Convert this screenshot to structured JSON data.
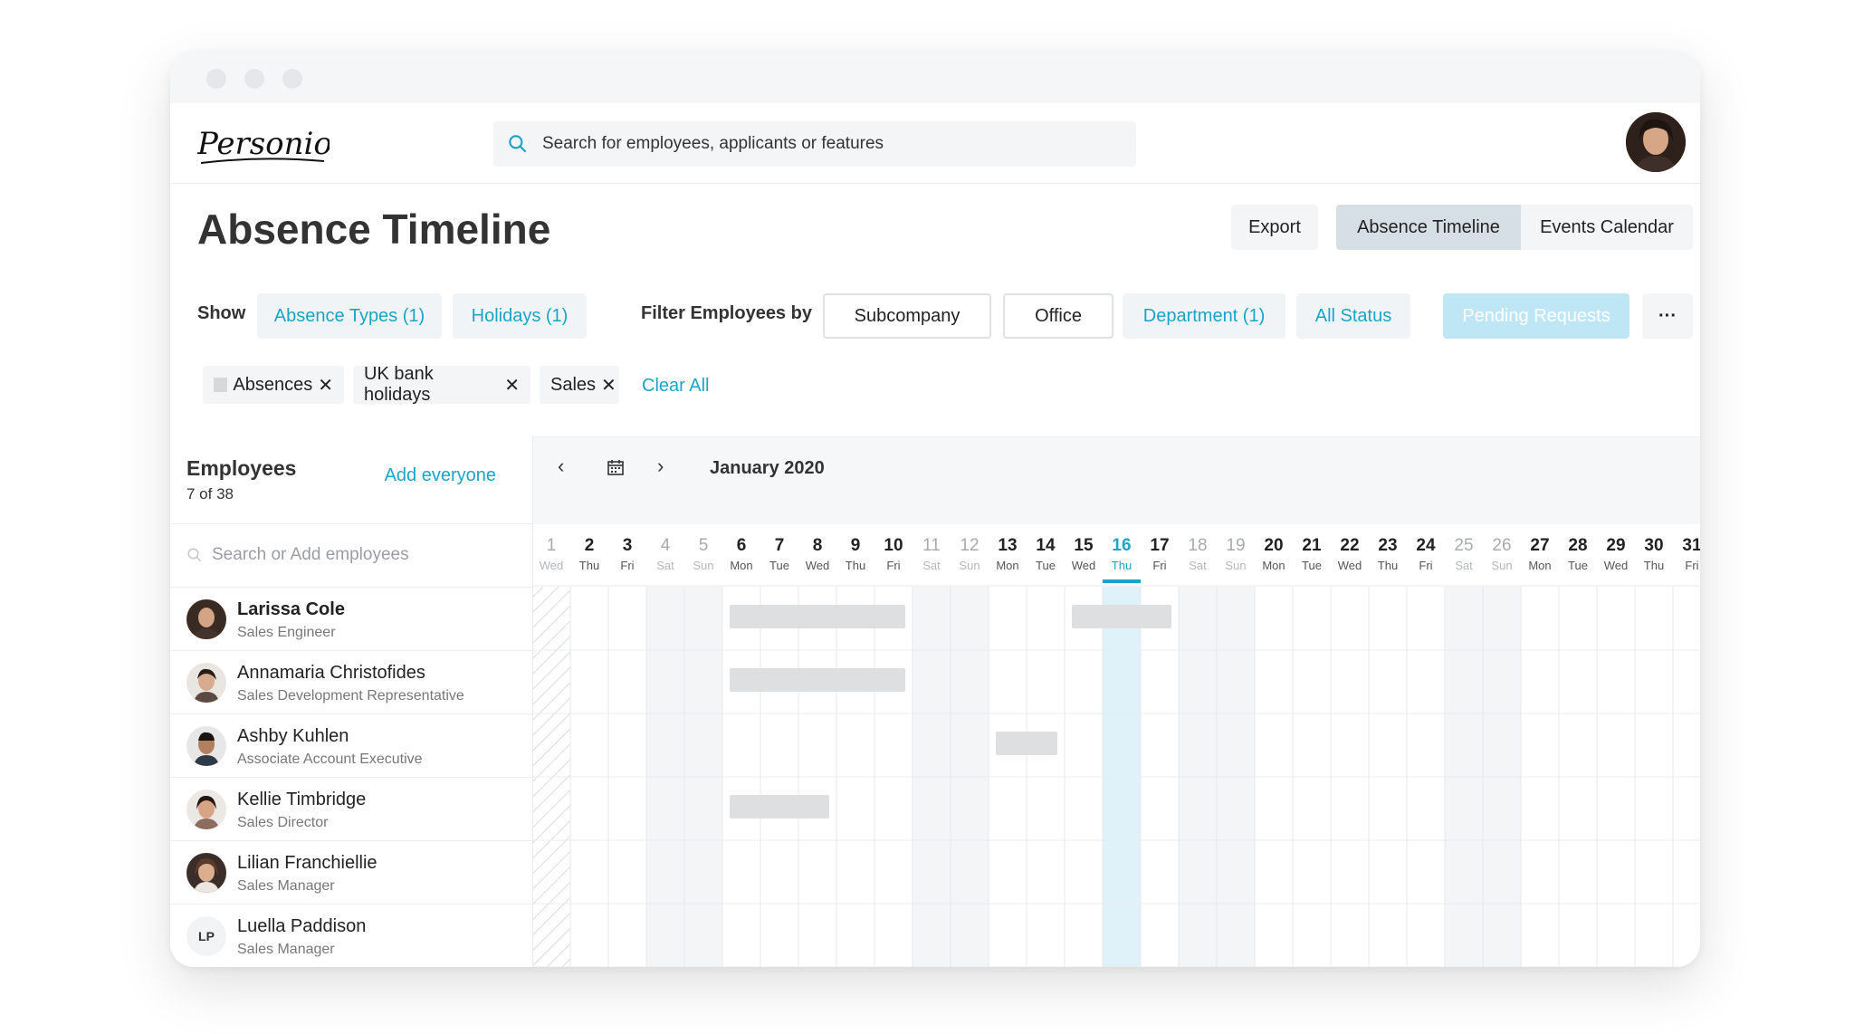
{
  "app": {
    "logo_text": "Personio"
  },
  "search": {
    "placeholder": "Search for employees, applicants or features"
  },
  "page": {
    "title": "Absence Timeline"
  },
  "toolbar": {
    "export": "Export",
    "absence_timeline": "Absence Timeline",
    "events_calendar": "Events Calendar"
  },
  "filters": {
    "show_label": "Show",
    "absence_types": "Absence Types (1)",
    "holidays": "Holidays (1)",
    "filter_label": "Filter Employees by",
    "subcompany": "Subcompany",
    "office": "Office",
    "department": "Department (1)",
    "all_status": "All Status",
    "pending_requests": "Pending Requests",
    "more": "···"
  },
  "chips": [
    {
      "label": "Absences"
    },
    {
      "label": "UK bank holidays"
    },
    {
      "label": "Sales"
    }
  ],
  "chip_close": "✕",
  "clear_all": "Clear All",
  "employees": {
    "title": "Employees",
    "count": "7 of 38",
    "add_everyone": "Add everyone",
    "search_placeholder": "Search or Add employees",
    "list": [
      {
        "name": "Larissa Cole",
        "role": "Sales Engineer"
      },
      {
        "name": "Annamaria Christofides",
        "role": "Sales Development Representative"
      },
      {
        "name": "Ashby Kuhlen",
        "role": "Associate Account Executive"
      },
      {
        "name": "Kellie Timbridge",
        "role": "Sales Director"
      },
      {
        "name": "Lilian Franchiellie",
        "role": "Sales Manager"
      },
      {
        "name": "Luella Paddison",
        "role": "Sales Manager",
        "initials": "LP"
      }
    ]
  },
  "calendar": {
    "month": "January 2020",
    "prev": "‹",
    "next": "›",
    "today": 16,
    "days": [
      {
        "d": "1",
        "w": "Wed"
      },
      {
        "d": "2",
        "w": "Thu"
      },
      {
        "d": "3",
        "w": "Fri"
      },
      {
        "d": "4",
        "w": "Sat"
      },
      {
        "d": "5",
        "w": "Sun"
      },
      {
        "d": "6",
        "w": "Mon"
      },
      {
        "d": "7",
        "w": "Tue"
      },
      {
        "d": "8",
        "w": "Wed"
      },
      {
        "d": "9",
        "w": "Thu"
      },
      {
        "d": "10",
        "w": "Fri"
      },
      {
        "d": "11",
        "w": "Sat"
      },
      {
        "d": "12",
        "w": "Sun"
      },
      {
        "d": "13",
        "w": "Mon"
      },
      {
        "d": "14",
        "w": "Tue"
      },
      {
        "d": "15",
        "w": "Wed"
      },
      {
        "d": "16",
        "w": "Thu"
      },
      {
        "d": "17",
        "w": "Fri"
      },
      {
        "d": "18",
        "w": "Sat"
      },
      {
        "d": "19",
        "w": "Sun"
      },
      {
        "d": "20",
        "w": "Mon"
      },
      {
        "d": "21",
        "w": "Tue"
      },
      {
        "d": "22",
        "w": "Wed"
      },
      {
        "d": "23",
        "w": "Thu"
      },
      {
        "d": "24",
        "w": "Fri"
      },
      {
        "d": "25",
        "w": "Sat"
      },
      {
        "d": "26",
        "w": "Sun"
      },
      {
        "d": "27",
        "w": "Mon"
      },
      {
        "d": "28",
        "w": "Tue"
      },
      {
        "d": "29",
        "w": "Wed"
      },
      {
        "d": "30",
        "w": "Thu"
      },
      {
        "d": "31",
        "w": "Fri"
      }
    ],
    "absences": [
      {
        "row": 0,
        "start": 6,
        "end": 10
      },
      {
        "row": 0,
        "start": 15,
        "end": 17
      },
      {
        "row": 1,
        "start": 6,
        "end": 10
      },
      {
        "row": 2,
        "start": 13,
        "end": 14
      },
      {
        "row": 3,
        "start": 6,
        "end": 8
      }
    ]
  },
  "colors": {
    "accent": "#1aa5c8",
    "today": "#dff2fa",
    "weekend": "#f3f5f7",
    "absence": "#dedfe1"
  }
}
